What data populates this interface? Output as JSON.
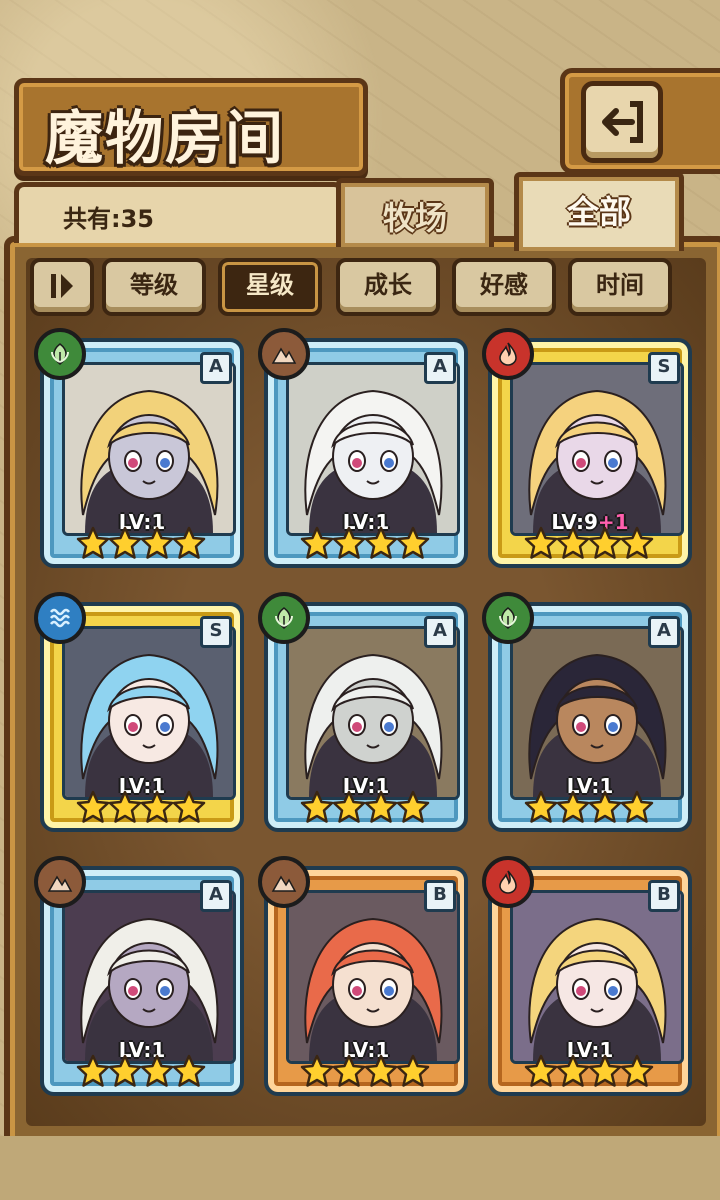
{
  "header": {
    "title": "魔物房间",
    "back_icon": "back-arrow-icon"
  },
  "count": {
    "label": "共有:35"
  },
  "tabs": [
    {
      "label": "牧场",
      "active": false
    },
    {
      "label": "全部",
      "active": true
    }
  ],
  "sort": {
    "toggle_icon": "pause-sort-icon",
    "options": [
      {
        "label": "等级",
        "active": false
      },
      {
        "label": "星级",
        "active": true
      },
      {
        "label": "成长",
        "active": false
      },
      {
        "label": "好感",
        "active": false
      },
      {
        "label": "时间",
        "active": false
      }
    ]
  },
  "colors": {
    "blue_frame": "#8fcbe6",
    "gold_frame": "#f3d54a",
    "bronze_frame": "#e79a48",
    "accent_plus": "#ff5fae"
  },
  "monsters": [
    {
      "frame": "blue",
      "rank": "A",
      "element": "nature",
      "level": "LV:1",
      "plus": "",
      "stars": 4
    },
    {
      "frame": "blue",
      "rank": "A",
      "element": "earth",
      "level": "LV:1",
      "plus": "",
      "stars": 4
    },
    {
      "frame": "gold",
      "rank": "S",
      "element": "fire",
      "level": "LV:9",
      "plus": "+1",
      "stars": 4
    },
    {
      "frame": "gold",
      "rank": "S",
      "element": "water",
      "level": "LV:1",
      "plus": "",
      "stars": 4
    },
    {
      "frame": "blue",
      "rank": "A",
      "element": "nature",
      "level": "LV:1",
      "plus": "",
      "stars": 4
    },
    {
      "frame": "blue",
      "rank": "A",
      "element": "nature",
      "level": "LV:1",
      "plus": "",
      "stars": 4
    },
    {
      "frame": "blue",
      "rank": "A",
      "element": "earth",
      "level": "LV:1",
      "plus": "",
      "stars": 4
    },
    {
      "frame": "bronze",
      "rank": "B",
      "element": "earth",
      "level": "LV:1",
      "plus": "",
      "stars": 4
    },
    {
      "frame": "bronze",
      "rank": "B",
      "element": "fire",
      "level": "LV:1",
      "plus": "",
      "stars": 4
    }
  ]
}
